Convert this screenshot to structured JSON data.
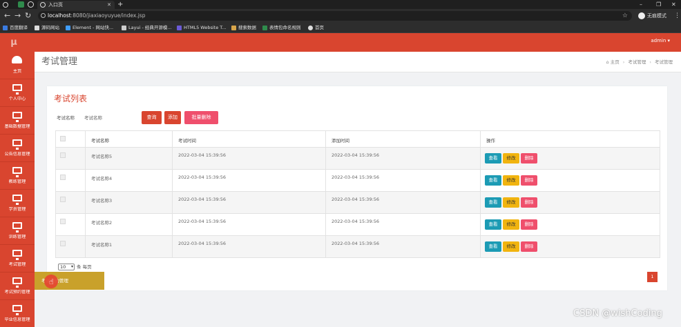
{
  "browser": {
    "active_tab_title": "入口页",
    "url_host": "localhost",
    "url_rest": ":8080/jiaxiaoyuyue/index.jsp",
    "profile_label": "无痕模式",
    "bookmarks": [
      "百度翻译",
      "源码网站",
      "Element - 网站快...",
      "Layui - 经典开源模...",
      "HTML5 Website T...",
      "搜索数据",
      "表情包命名规则",
      "首页"
    ],
    "window_controls": [
      "–",
      "❐",
      "✕"
    ]
  },
  "app": {
    "logo": "μ",
    "user": "admin ▾",
    "accent_color": "#d9452f"
  },
  "sidebar": {
    "items": [
      {
        "label": "主页",
        "icon": "dashboard-icon"
      },
      {
        "label": "个人中心",
        "icon": "monitor-icon"
      },
      {
        "label": "基础数据管理",
        "icon": "monitor-icon"
      },
      {
        "label": "公告信息管理",
        "icon": "monitor-icon"
      },
      {
        "label": "教练管理",
        "icon": "monitor-icon"
      },
      {
        "label": "学员管理",
        "icon": "monitor-icon"
      },
      {
        "label": "训练管理",
        "icon": "monitor-icon"
      },
      {
        "label": "考试管理",
        "icon": "monitor-icon"
      },
      {
        "label": "考试预约管理",
        "icon": "monitor-icon"
      },
      {
        "label": "毕业信息管理",
        "icon": "monitor-icon"
      }
    ]
  },
  "page": {
    "title": "考试管理",
    "breadcrumb": [
      "⌂ 主页",
      "考试管理",
      "考试管理"
    ]
  },
  "card": {
    "title": "考试列表",
    "search_label": "考试名称",
    "search_placeholder": "考试名称",
    "query_btn": "查询",
    "add_btn": "添加",
    "bulk_delete_btn": "批量删除"
  },
  "table": {
    "headers": [
      "考试名称",
      "考试时间",
      "添加时间",
      "操作"
    ],
    "rows": [
      {
        "name": "考试名称5",
        "exam_time": "2022-03-04 15:39:56",
        "add_time": "2022-03-04 15:39:56"
      },
      {
        "name": "考试名称4",
        "exam_time": "2022-03-04 15:39:56",
        "add_time": "2022-03-04 15:39:56"
      },
      {
        "name": "考试名称3",
        "exam_time": "2022-03-04 15:39:56",
        "add_time": "2022-03-04 15:39:56"
      },
      {
        "name": "考试名称2",
        "exam_time": "2022-03-04 15:39:56",
        "add_time": "2022-03-04 15:39:56"
      },
      {
        "name": "考试名称1",
        "exam_time": "2022-03-04 15:39:56",
        "add_time": "2022-03-04 15:39:56"
      }
    ],
    "view_btn": "查看",
    "edit_btn": "修改",
    "delete_btn": "删除"
  },
  "pager": {
    "page_size": "10",
    "per_page_label": "条 每页",
    "current_page": "1"
  },
  "tooltip": "考试预约管理",
  "watermark": "CSDN @wishCoding"
}
